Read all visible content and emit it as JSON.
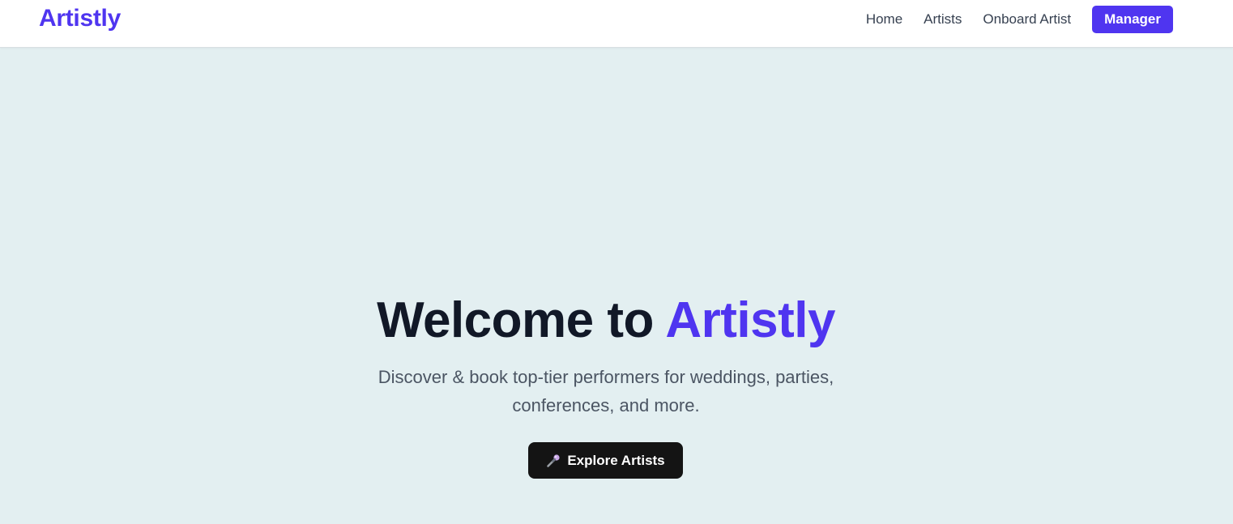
{
  "navbar": {
    "brand": "Artistly",
    "links": [
      {
        "label": "Home"
      },
      {
        "label": "Artists"
      },
      {
        "label": "Onboard Artist"
      }
    ],
    "button_label": "Manager"
  },
  "hero": {
    "title_prefix": "Welcome to ",
    "title_accent": "Artistly",
    "subtitle_line1": "Discover & book top-tier performers for weddings, parties,",
    "subtitle_line2": "conferences, and more.",
    "cta_label": "Explore Artists",
    "cta_icon": "microphone-icon"
  },
  "colors": {
    "accent": "#4f35f0",
    "background": "#e3eff1",
    "cta_background": "#141414",
    "title_text": "#111827"
  }
}
